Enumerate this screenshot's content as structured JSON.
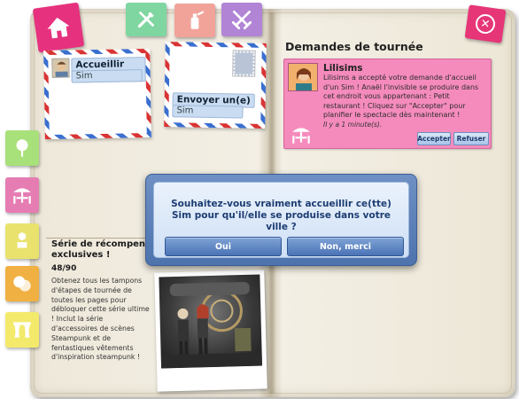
{
  "cards": {
    "welcome": {
      "title": "Accueillir un(e)",
      "subtitle": "Sim"
    },
    "send": {
      "title": "Envoyer un(e)",
      "subtitle": "Sim"
    }
  },
  "requests": {
    "section_title": "Demandes de tournée",
    "notification": {
      "name": "Lilisims",
      "body": "Lilisims a accepté votre demande d'accueil d'un Sim ! Anaël l'invisible se produire dans cet endroit vous appartenant : Petit restaurant ! Cliquez sur \"Accepter\" pour planifier le spectacle dès maintenant !",
      "time": "Il y a 1 minute(s).",
      "accept_label": "Accepter",
      "refuse_label": "Refuser"
    }
  },
  "series": {
    "title_line1": "Série de récompen",
    "title_line2": "exclusives !",
    "count": "48/90",
    "description": "Obtenez tous les tampons d'étapes de tournée de toutes les pages pour débloquer cette série ultime ! Inclut la série d'accessoires de scènes Steampunk et de fentastiques vêtements d'inspiration steampunk !"
  },
  "modal": {
    "question": "Souhaitez-vous vraiment accueillir ce(tte) Sim pour qu'il/elle se produise dans votre ville ?",
    "yes_label": "Oui",
    "no_label": "Non, merci"
  },
  "colors": {
    "home_tab": "#e6327e",
    "close_tab": "#e63678",
    "notification_bg": "#f58bbd",
    "modal_bg": "#4d73ad"
  },
  "icons": {
    "top_tabs": [
      "home-icon",
      "tools-icon",
      "spray-icon",
      "swords-icon"
    ],
    "side_tabs": [
      "tree-icon",
      "cafe-table-icon",
      "stage-icon",
      "masks-icon",
      "curtain-icon"
    ]
  }
}
